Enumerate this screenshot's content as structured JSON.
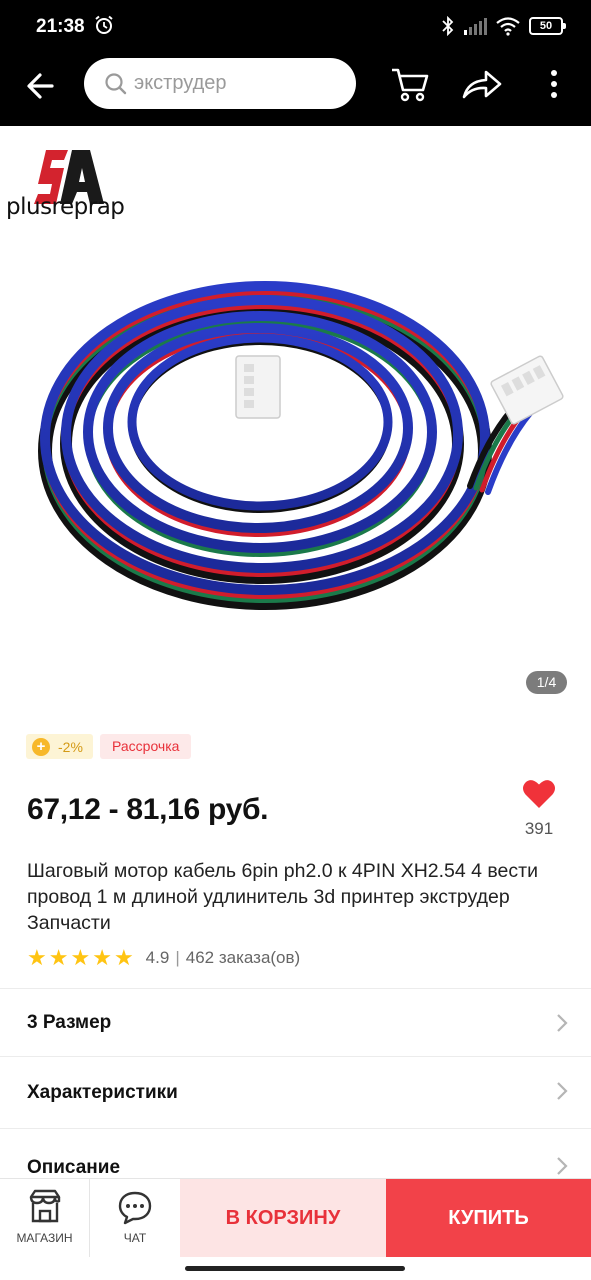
{
  "status_bar": {
    "time": "21:38",
    "battery": "50"
  },
  "app_bar": {
    "search_placeholder": "экструдер"
  },
  "brand": {
    "name": "plusreprap"
  },
  "gallery": {
    "counter": "1/4"
  },
  "tags": {
    "coin": "-2%",
    "installment": "Рассрочка"
  },
  "product": {
    "price": "67,12 - 81,16 руб.",
    "wishlist_count": "391",
    "title": "Шаговый мотор кабель 6pin ph2.0 к 4PIN XH2.54 4 вести провод 1 м длиной удлинитель 3d принтер экструдер Запчасти",
    "rating": "4.9",
    "stars": 5,
    "orders": "462 заказа(ов)"
  },
  "sections": [
    {
      "label": "3 Размер"
    },
    {
      "label": "Характеристики"
    },
    {
      "label": "Описание"
    }
  ],
  "bottom_bar": {
    "store": "МАГАЗИН",
    "chat": "ЧАТ",
    "add_to_cart": "В КОРЗИНУ",
    "buy": "КУПИТЬ"
  },
  "colors": {
    "accent": "#f24249",
    "accent_light": "#fde4e4",
    "star": "#ffc412",
    "heart": "#f0323a"
  }
}
